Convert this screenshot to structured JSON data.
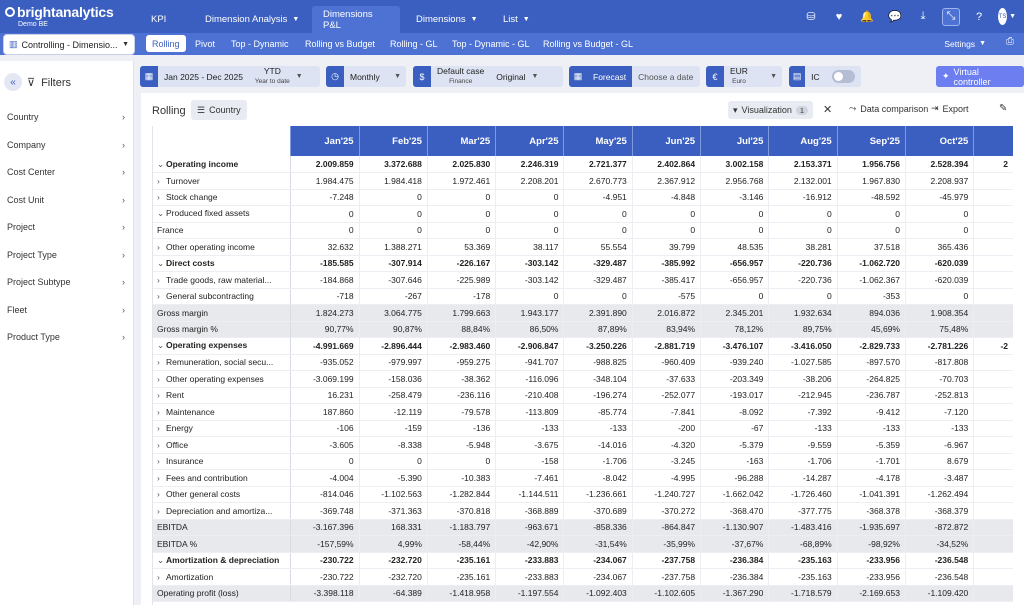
{
  "app": {
    "logo": "brightanalytics",
    "sublogo": "Demo BE"
  },
  "nav": {
    "tabs": [
      {
        "label": "KPI",
        "dropdown": false
      },
      {
        "label": "Dimension Analysis",
        "dropdown": true
      },
      {
        "label": "Dimensions P&L",
        "dropdown": false,
        "active": true
      },
      {
        "label": "Dimensions",
        "dropdown": true
      },
      {
        "label": "List",
        "dropdown": true
      }
    ],
    "avatar": "TS"
  },
  "subnav": {
    "selector": "Controlling - Dimensio...",
    "tabs": [
      "Rolling",
      "Pivot",
      "Top - Dynamic",
      "Rolling vs Budget",
      "Rolling - GL",
      "Top - Dynamic - GL",
      "Rolling vs Budget - GL"
    ],
    "settings": "Settings"
  },
  "sidebar": {
    "title": "Filters",
    "items": [
      "Country",
      "Company",
      "Cost Center",
      "Cost Unit",
      "Project",
      "Project Type",
      "Project Subtype",
      "Fleet",
      "Product Type"
    ]
  },
  "controls": {
    "period": {
      "range": "Jan 2025 - Dec 2025",
      "mode": "YTD",
      "mode_sub": "Year to date"
    },
    "frequency": "Monthly",
    "scenario": {
      "label": "Default case",
      "sub": "Finance",
      "type": "Original"
    },
    "forecast": {
      "label": "Forecast",
      "placeholder": "Choose a date"
    },
    "currency": {
      "code": "EUR",
      "name": "Euro"
    },
    "ic": "IC",
    "virtual_controller": "Virtual controller"
  },
  "panel": {
    "title": "Rolling",
    "chip": "Country",
    "visualization": "Visualization",
    "viz_count": "1",
    "data_comparison": "Data comparison",
    "export": "Export"
  },
  "table": {
    "columns": [
      "Jan'25",
      "Feb'25",
      "Mar'25",
      "Apr'25",
      "May'25",
      "Jun'25",
      "Jul'25",
      "Aug'25",
      "Sep'25",
      "Oct'25",
      ""
    ],
    "rows": [
      {
        "label": "Operating income",
        "level": 1,
        "bold": true,
        "expand": "down",
        "values": [
          "2.009.859",
          "3.372.688",
          "2.025.830",
          "2.246.319",
          "2.721.377",
          "2.402.864",
          "3.002.158",
          "2.153.371",
          "1.956.756",
          "2.528.394",
          "2"
        ]
      },
      {
        "label": "Turnover",
        "level": 2,
        "expand": "right",
        "values": [
          "1.984.475",
          "1.984.418",
          "1.972.461",
          "2.208.201",
          "2.670.773",
          "2.367.912",
          "2.956.768",
          "2.132.001",
          "1.967.830",
          "2.208.937",
          ""
        ]
      },
      {
        "label": "Stock change",
        "level": 2,
        "expand": "right",
        "values": [
          "-7.248",
          "0",
          "0",
          "0",
          "-4.951",
          "-4.848",
          "-3.146",
          "-16.912",
          "-48.592",
          "-45.979",
          ""
        ]
      },
      {
        "label": "Produced fixed assets",
        "level": 2,
        "expand": "down",
        "values": [
          "0",
          "0",
          "0",
          "0",
          "0",
          "0",
          "0",
          "0",
          "0",
          "0",
          ""
        ]
      },
      {
        "label": "France",
        "level": 3,
        "expand": "none",
        "values": [
          "0",
          "0",
          "0",
          "0",
          "0",
          "0",
          "0",
          "0",
          "0",
          "0",
          ""
        ]
      },
      {
        "label": "Other operating income",
        "level": 2,
        "expand": "right",
        "values": [
          "32.632",
          "1.388.271",
          "53.369",
          "38.117",
          "55.554",
          "39.799",
          "48.535",
          "38.281",
          "37.518",
          "365.436",
          ""
        ]
      },
      {
        "label": "Direct costs",
        "level": 1,
        "bold": true,
        "expand": "down",
        "values": [
          "-185.585",
          "-307.914",
          "-226.167",
          "-303.142",
          "-329.487",
          "-385.992",
          "-656.957",
          "-220.736",
          "-1.062.720",
          "-620.039",
          ""
        ]
      },
      {
        "label": "Trade goods, raw material...",
        "level": 2,
        "expand": "right",
        "values": [
          "-184.868",
          "-307.646",
          "-225.989",
          "-303.142",
          "-329.487",
          "-385.417",
          "-656.957",
          "-220.736",
          "-1.062.367",
          "-620.039",
          ""
        ]
      },
      {
        "label": "General subcontracting",
        "level": 2,
        "expand": "right",
        "values": [
          "-718",
          "-267",
          "-178",
          "0",
          "0",
          "-575",
          "0",
          "0",
          "-353",
          "0",
          ""
        ]
      },
      {
        "label": "Gross margin",
        "level": 0,
        "total": true,
        "values": [
          "1.824.273",
          "3.064.775",
          "1.799.663",
          "1.943.177",
          "2.391.890",
          "2.016.872",
          "2.345.201",
          "1.932.634",
          "894.036",
          "1.908.354",
          ""
        ]
      },
      {
        "label": "Gross margin %",
        "level": 0,
        "total": true,
        "values": [
          "90,77%",
          "90,87%",
          "88,84%",
          "86,50%",
          "87,89%",
          "83,94%",
          "78,12%",
          "89,75%",
          "45,69%",
          "75,48%",
          ""
        ]
      },
      {
        "label": "Operating expenses",
        "level": 1,
        "bold": true,
        "expand": "down",
        "values": [
          "-4.991.669",
          "-2.896.444",
          "-2.983.460",
          "-2.906.847",
          "-3.250.226",
          "-2.881.719",
          "-3.476.107",
          "-3.416.050",
          "-2.829.733",
          "-2.781.226",
          "-2"
        ]
      },
      {
        "label": "Remuneration, social secu...",
        "level": 2,
        "expand": "right",
        "values": [
          "-935.052",
          "-979.997",
          "-959.275",
          "-941.707",
          "-988.825",
          "-960.409",
          "-939.240",
          "-1.027.585",
          "-897.570",
          "-817.808",
          ""
        ]
      },
      {
        "label": "Other operating expenses",
        "level": 2,
        "expand": "right",
        "values": [
          "-3.069.199",
          "-158.036",
          "-38.362",
          "-116.096",
          "-348.104",
          "-37.633",
          "-203.349",
          "-38.206",
          "-264.825",
          "-70.703",
          ""
        ]
      },
      {
        "label": "Rent",
        "level": 2,
        "expand": "right",
        "values": [
          "16.231",
          "-258.479",
          "-236.116",
          "-210.408",
          "-196.274",
          "-252.077",
          "-193.017",
          "-212.945",
          "-236.787",
          "-252.813",
          ""
        ]
      },
      {
        "label": "Maintenance",
        "level": 2,
        "expand": "right",
        "values": [
          "187.860",
          "-12.119",
          "-79.578",
          "-113.809",
          "-85.774",
          "-7.841",
          "-8.092",
          "-7.392",
          "-9.412",
          "-7.120",
          ""
        ]
      },
      {
        "label": "Energy",
        "level": 2,
        "expand": "right",
        "values": [
          "-106",
          "-159",
          "-136",
          "-133",
          "-133",
          "-200",
          "-67",
          "-133",
          "-133",
          "-133",
          ""
        ]
      },
      {
        "label": "Office",
        "level": 2,
        "expand": "right",
        "values": [
          "-3.605",
          "-8.338",
          "-5.948",
          "-3.675",
          "-14.016",
          "-4.320",
          "-5.379",
          "-9.559",
          "-5.359",
          "-6.967",
          ""
        ]
      },
      {
        "label": "Insurance",
        "level": 2,
        "expand": "right",
        "values": [
          "0",
          "0",
          "0",
          "-158",
          "-1.706",
          "-3.245",
          "-163",
          "-1.706",
          "-1.701",
          "8.679",
          ""
        ]
      },
      {
        "label": "Fees and contribution",
        "level": 2,
        "expand": "right",
        "values": [
          "-4.004",
          "-5.390",
          "-10.383",
          "-7.461",
          "-8.042",
          "-4.995",
          "-96.288",
          "-14.287",
          "-4.178",
          "-3.487",
          ""
        ]
      },
      {
        "label": "Other general costs",
        "level": 2,
        "expand": "right",
        "values": [
          "-814.046",
          "-1.102.563",
          "-1.282.844",
          "-1.144.511",
          "-1.236.661",
          "-1.240.727",
          "-1.662.042",
          "-1.726.460",
          "-1.041.391",
          "-1.262.494",
          ""
        ]
      },
      {
        "label": "Depreciation and amortiza...",
        "level": 2,
        "expand": "right",
        "values": [
          "-369.748",
          "-371.363",
          "-370.818",
          "-368.889",
          "-370.689",
          "-370.272",
          "-368.470",
          "-377.775",
          "-368.378",
          "-368.379",
          ""
        ]
      },
      {
        "label": "EBITDA",
        "level": 0,
        "total": true,
        "values": [
          "-3.167.396",
          "168.331",
          "-1.183.797",
          "-963.671",
          "-858.336",
          "-864.847",
          "-1.130.907",
          "-1.483.416",
          "-1.935.697",
          "-872.872",
          ""
        ]
      },
      {
        "label": "EBITDA %",
        "level": 0,
        "total": true,
        "values": [
          "-157,59%",
          "4,99%",
          "-58,44%",
          "-42,90%",
          "-31,54%",
          "-35,99%",
          "-37,67%",
          "-68,89%",
          "-98,92%",
          "-34,52%",
          ""
        ]
      },
      {
        "label": "Amortization & depreciation",
        "level": 1,
        "bold": true,
        "expand": "down",
        "values": [
          "-230.722",
          "-232.720",
          "-235.161",
          "-233.883",
          "-234.067",
          "-237.758",
          "-236.384",
          "-235.163",
          "-233.956",
          "-236.548",
          ""
        ]
      },
      {
        "label": "Amortization",
        "level": 2,
        "expand": "right",
        "values": [
          "-230.722",
          "-232.720",
          "-235.161",
          "-233.883",
          "-234.067",
          "-237.758",
          "-236.384",
          "-235.163",
          "-233.956",
          "-236.548",
          ""
        ]
      },
      {
        "label": "Operating profit (loss)",
        "level": 0,
        "total": true,
        "values": [
          "-3.398.118",
          "-64.389",
          "-1.418.958",
          "-1.197.554",
          "-1.092.403",
          "-1.102.605",
          "-1.367.290",
          "-1.718.579",
          "-2.169.653",
          "-1.109.420",
          ""
        ]
      }
    ]
  }
}
